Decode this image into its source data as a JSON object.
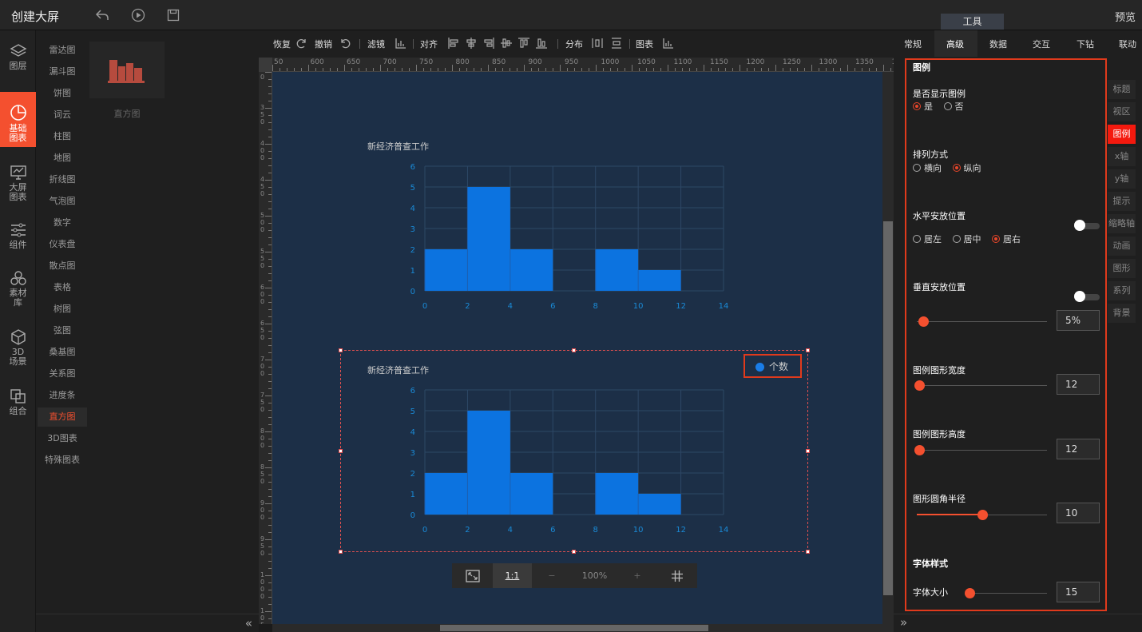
{
  "app": {
    "title": "创建大屏",
    "preview_label": "预览",
    "tools_tab": "工具"
  },
  "leftnav": [
    {
      "label": "图层",
      "icon": "layers-icon"
    },
    {
      "label": "基础\n图表",
      "icon": "pie-chart-icon",
      "active": true
    },
    {
      "label": "大屏\n图表",
      "icon": "monitor-chart-icon"
    },
    {
      "label": "组件",
      "icon": "sliders-icon"
    },
    {
      "label": "素材\n库",
      "icon": "hexagons-icon"
    },
    {
      "label": "3D\n场景",
      "icon": "cube-icon"
    },
    {
      "label": "组合",
      "icon": "combine-icon"
    }
  ],
  "categories": [
    "雷达图",
    "漏斗图",
    "饼图",
    "词云",
    "柱图",
    "地图",
    "折线图",
    "气泡图",
    "数字",
    "仪表盘",
    "散点图",
    "表格",
    "树图",
    "弦图",
    "桑基图",
    "关系图",
    "进度条",
    "直方图",
    "3D图表",
    "特殊图表"
  ],
  "active_category": "直方图",
  "thumbnail": {
    "label": "直方图"
  },
  "toolbar": {
    "redo": "恢复",
    "undo": "撤销",
    "filter": "滤镜",
    "align": "对齐",
    "distribute": "分布",
    "chart": "图表"
  },
  "ruler": {
    "top_labels": [
      "50",
      "600",
      "650",
      "700",
      "750",
      "800",
      "850",
      "900",
      "950",
      "1000",
      "1050",
      "1100",
      "1150",
      "1200",
      "1250",
      "1300",
      "1350",
      "1400"
    ],
    "left_labels": [
      "0",
      "350",
      "400",
      "450",
      "500",
      "550",
      "600",
      "650",
      "700",
      "750",
      "800",
      "850",
      "900",
      "950",
      "1000",
      "1050"
    ]
  },
  "chart_data": [
    {
      "type": "bar",
      "title": "新经济普查工作",
      "x": [
        0,
        2,
        4,
        6,
        8,
        10,
        12,
        14
      ],
      "bins": [
        [
          0,
          2,
          2
        ],
        [
          2,
          4,
          5
        ],
        [
          4,
          6,
          2
        ],
        [
          6,
          8,
          0
        ],
        [
          8,
          10,
          2
        ],
        [
          10,
          12,
          1
        ]
      ],
      "ylim": [
        0,
        6
      ],
      "yticks": [
        0,
        1,
        2,
        3,
        4,
        5,
        6
      ],
      "xticks": [
        0,
        2,
        4,
        6,
        8,
        10,
        12,
        14
      ],
      "grid": true,
      "color": "#0c73e0"
    },
    {
      "type": "bar",
      "title": "新经济普查工作",
      "x": [
        0,
        2,
        4,
        6,
        8,
        10,
        12,
        14
      ],
      "bins": [
        [
          0,
          2,
          2
        ],
        [
          2,
          4,
          5
        ],
        [
          4,
          6,
          2
        ],
        [
          6,
          8,
          0
        ],
        [
          8,
          10,
          2
        ],
        [
          10,
          12,
          1
        ]
      ],
      "ylim": [
        0,
        6
      ],
      "yticks": [
        0,
        1,
        2,
        3,
        4,
        5,
        6
      ],
      "xticks": [
        0,
        2,
        4,
        6,
        8,
        10,
        12,
        14
      ],
      "grid": true,
      "color": "#0c73e0",
      "legend": {
        "label": "个数",
        "position": "top-right"
      }
    }
  ],
  "zoom": {
    "ratio_label": "1:1",
    "minus": "−",
    "value": "100%",
    "plus": "+"
  },
  "right_tabs": [
    "常规",
    "高级",
    "数据",
    "交互",
    "下钻",
    "联动"
  ],
  "active_right_tab": "高级",
  "side_tabs": [
    "标题",
    "视区",
    "图例",
    "x轴",
    "y轴",
    "提示",
    "缩略轴",
    "动画",
    "图形",
    "系列",
    "背景"
  ],
  "active_side_tab": "图例",
  "legend_settings": {
    "section": "图例",
    "show_label": "是否显示图例",
    "show_yes": "是",
    "show_no": "否",
    "layout_label": "排列方式",
    "layout_h": "横向",
    "layout_v": "纵向",
    "hpos_label": "水平安放位置",
    "hpos_left": "居左",
    "hpos_center": "居中",
    "hpos_right": "居右",
    "vpos_label": "垂直安放位置",
    "vpos_value": "5%",
    "width_label": "图例图形宽度",
    "width_value": "12",
    "height_label": "图例图形高度",
    "height_value": "12",
    "radius_label": "图形圆角半径",
    "radius_value": "10",
    "font_section": "字体样式",
    "font_size_label": "字体大小",
    "font_size_value": "15"
  }
}
